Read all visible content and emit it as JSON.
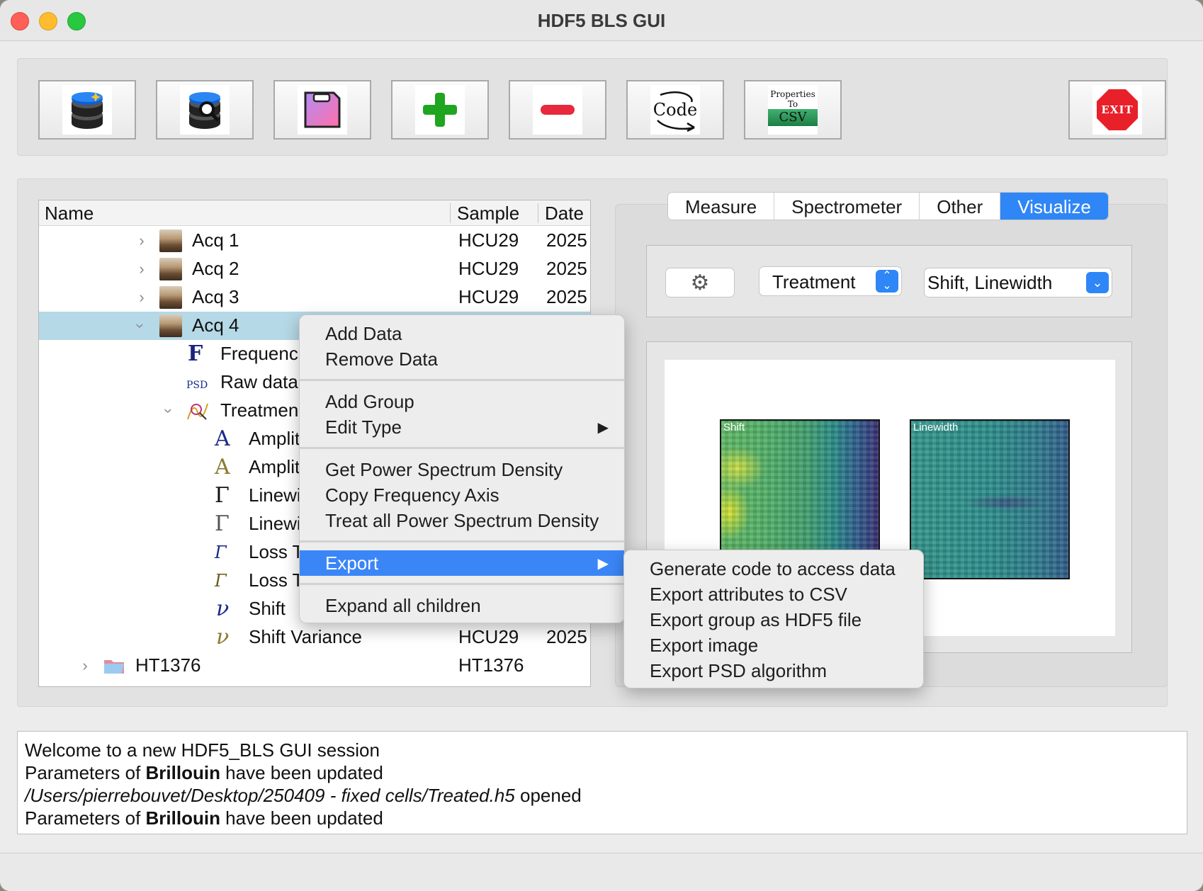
{
  "window": {
    "title": "HDF5 BLS GUI"
  },
  "toolbar": {
    "buttons": [
      {
        "name": "open-database-button",
        "icon": "database-icon"
      },
      {
        "name": "search-database-button",
        "icon": "database-search-icon"
      },
      {
        "name": "save-button",
        "icon": "floppy-icon"
      },
      {
        "name": "add-button",
        "icon": "plus-icon"
      },
      {
        "name": "remove-button",
        "icon": "minus-icon"
      },
      {
        "name": "code-button",
        "icon": "code-icon",
        "label": "Code"
      },
      {
        "name": "properties-to-csv-button",
        "icon": "csv-icon",
        "label_line1": "Properties",
        "label_line2": "To",
        "label_line3": "CSV"
      },
      {
        "name": "exit-button",
        "icon": "exit-sign-icon",
        "label": "EXIT"
      }
    ]
  },
  "tree": {
    "columns": {
      "name": "Name",
      "sample": "Sample",
      "date": "Date"
    },
    "rows": [
      {
        "label": "Acq 1",
        "sample": "HCU29",
        "date": "2025"
      },
      {
        "label": "Acq 2",
        "sample": "HCU29",
        "date": "2025"
      },
      {
        "label": "Acq 3",
        "sample": "HCU29",
        "date": "2025"
      },
      {
        "label": "Acq 4",
        "sample": "",
        "date": ""
      },
      {
        "label": "Frequenc",
        "sample": "",
        "date": ""
      },
      {
        "label": "Raw data",
        "sample": "",
        "date": ""
      },
      {
        "label": "Treatmen",
        "sample": "",
        "date": ""
      },
      {
        "label": "Amplit",
        "sample": "",
        "date": ""
      },
      {
        "label": "Amplit",
        "sample": "",
        "date": ""
      },
      {
        "label": "Linewi",
        "sample": "",
        "date": ""
      },
      {
        "label": "Linewi",
        "sample": "",
        "date": ""
      },
      {
        "label": "Loss T",
        "sample": "",
        "date": ""
      },
      {
        "label": "Loss T",
        "sample": "",
        "date": ""
      },
      {
        "label": "Shift",
        "sample": "",
        "date": ""
      },
      {
        "label": "Shift Variance",
        "sample": "HCU29",
        "date": "2025"
      },
      {
        "label": "HT1376",
        "sample": "HT1376",
        "date": ""
      }
    ],
    "glyphs": {
      "frequency": "F",
      "psd": "PSD",
      "amplitude": "A",
      "linewidth": "Γ",
      "loss": "Γ",
      "shift": "ν"
    }
  },
  "tabs": [
    "Measure",
    "Spectrometer",
    "Other",
    "Visualize"
  ],
  "controls": {
    "settings_icon": "gear-icon",
    "group_select": "Treatment",
    "data_select": "Shift, Linewidth"
  },
  "plots": {
    "left_title": "Shift",
    "right_title": "Linewidth"
  },
  "context_menu": {
    "items": [
      "Add Data",
      "Remove Data",
      "Add Group",
      "Edit Type",
      "Get Power Spectrum Density",
      "Copy Frequency Axis",
      "Treat all Power Spectrum Density",
      "Export",
      "Expand all children"
    ],
    "submenu_arrow": "▶"
  },
  "export_submenu": {
    "items": [
      "Generate code to access data",
      "Export attributes to CSV",
      "Export group as HDF5 file",
      "Export image",
      "Export PSD algorithm"
    ]
  },
  "log": {
    "line1": "Welcome to a new HDF5_BLS GUI session",
    "line2_pre": "Parameters of ",
    "line2_bold": "Brillouin",
    "line2_post": " have been updated",
    "line3_italic": "/Users/pierrebouvet/Desktop/250409 - fixed cells/Treated.h5",
    "line3_post": " opened",
    "line4_pre": "Parameters of ",
    "line4_bold": "Brillouin",
    "line4_post": " have been updated"
  }
}
